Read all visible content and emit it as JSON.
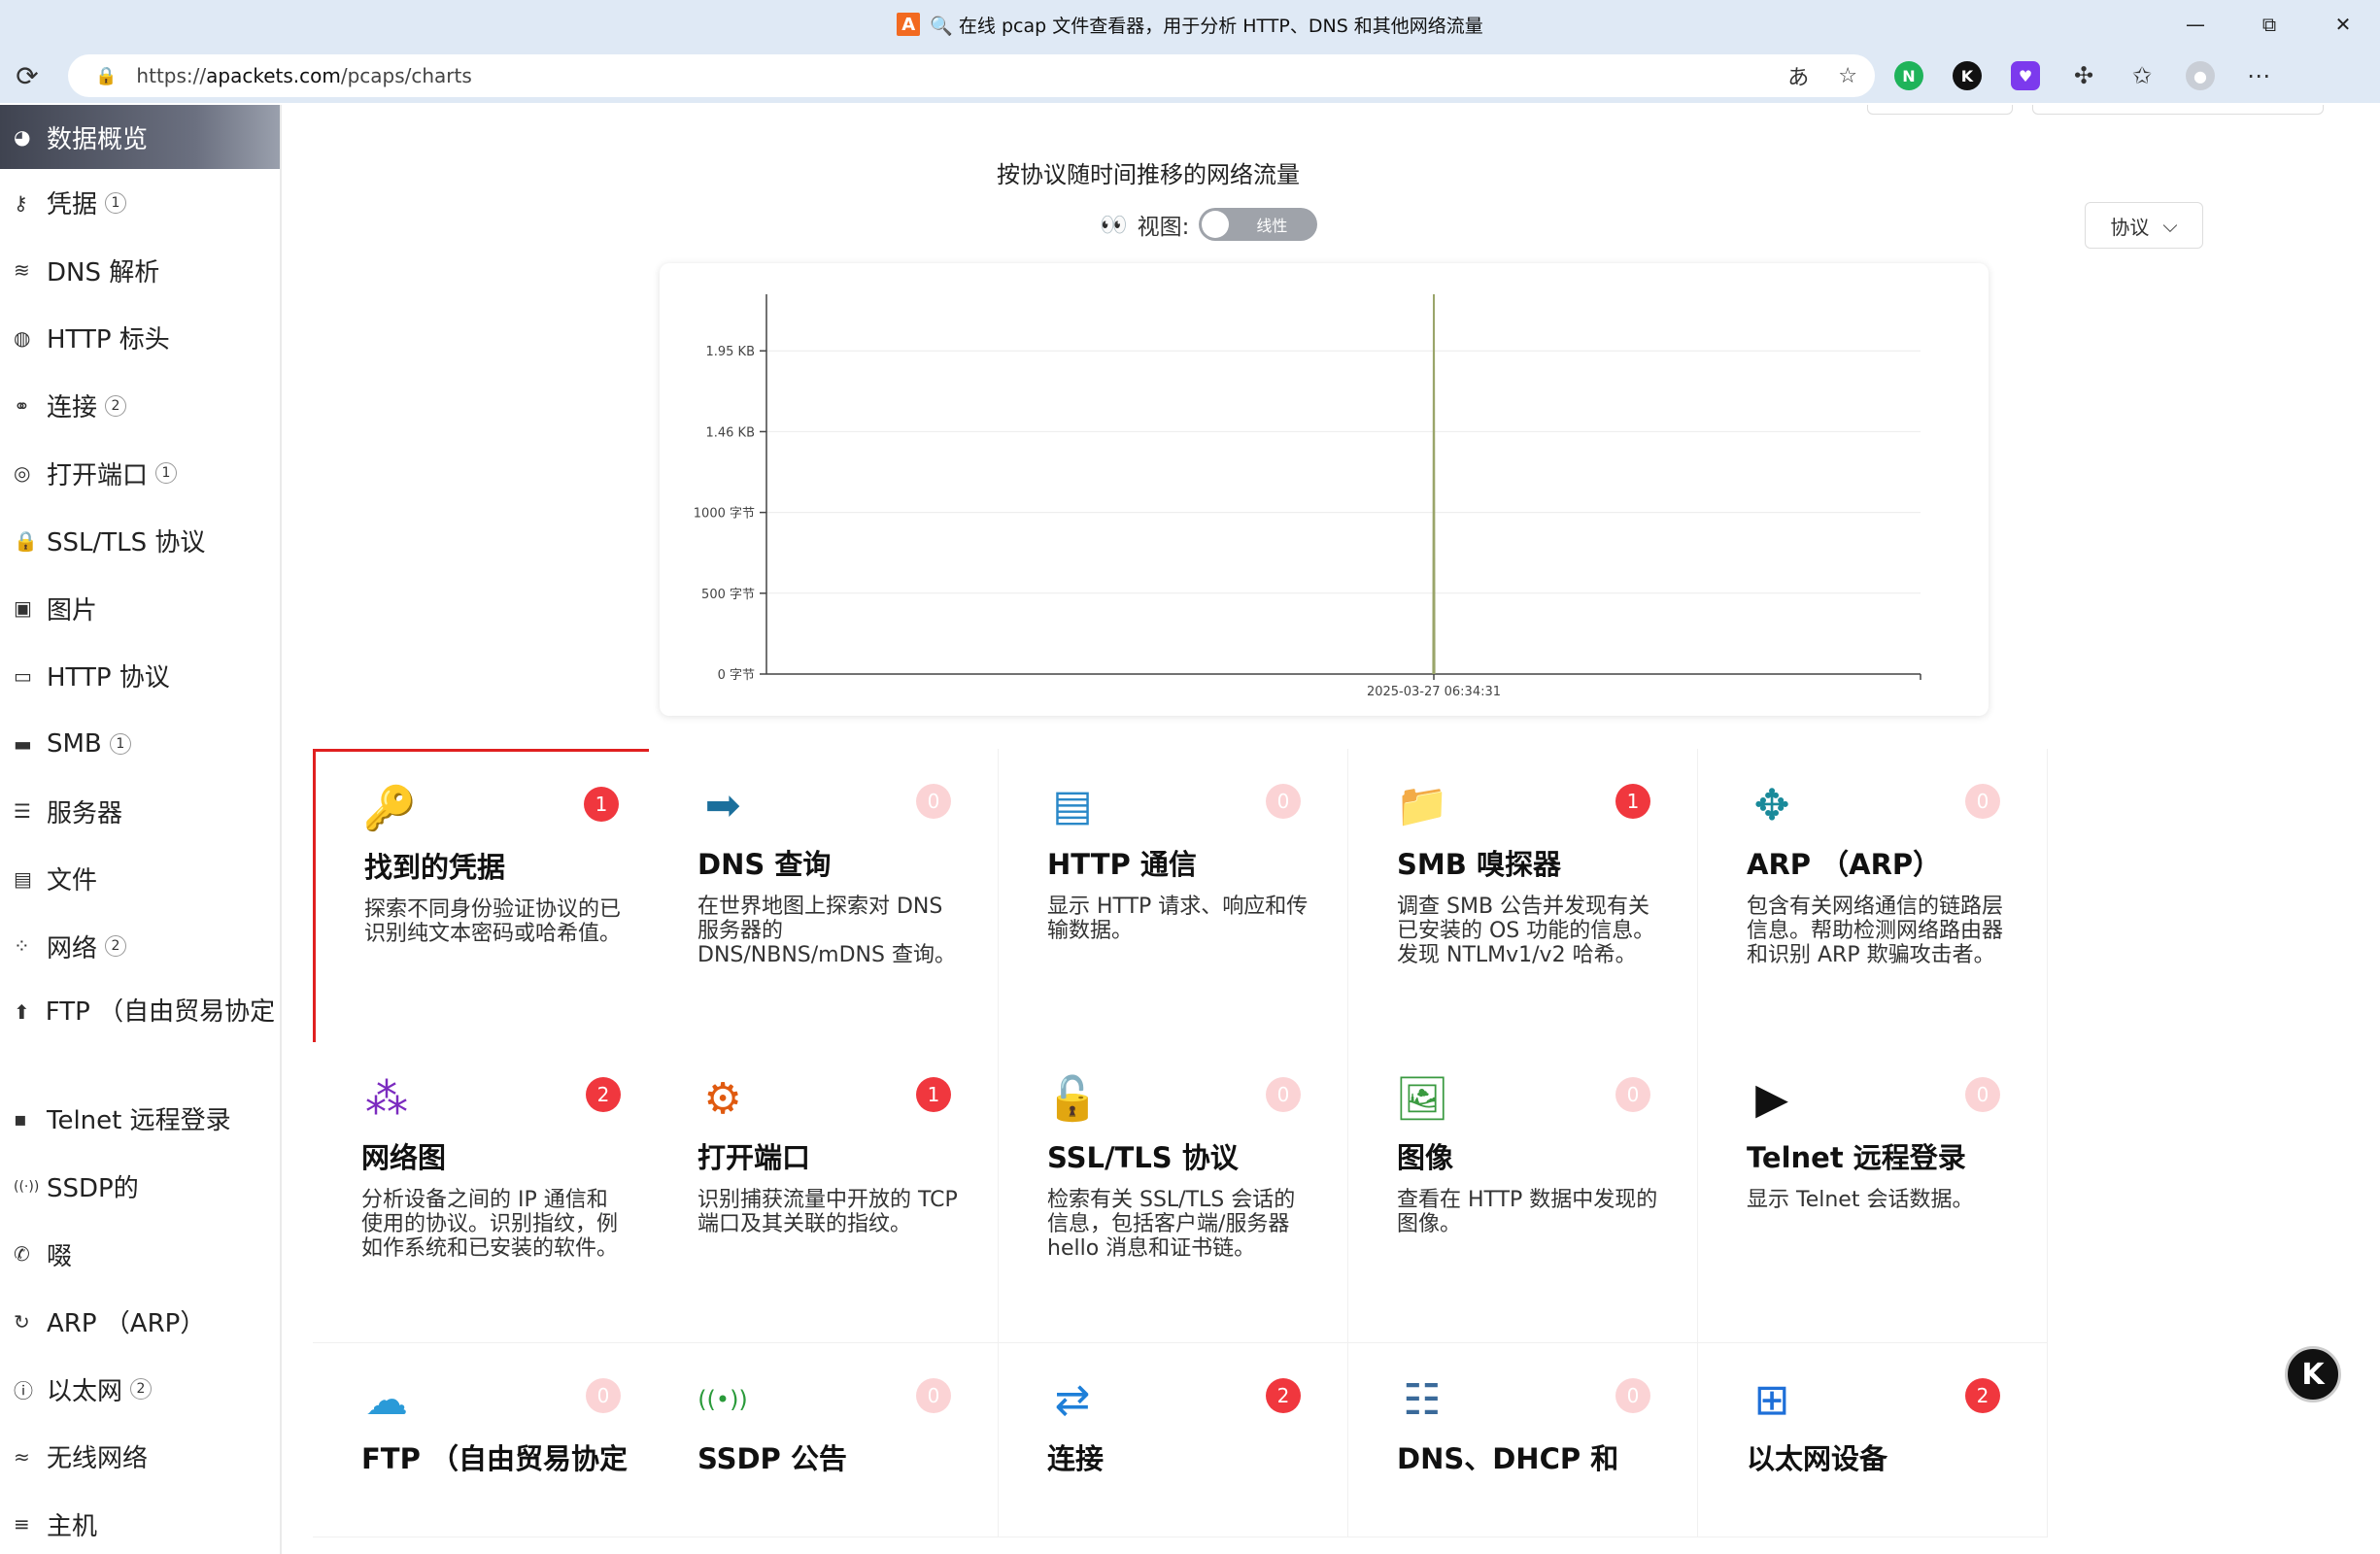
{
  "window": {
    "title": "🔍 在线 pcap 文件查看器，用于分析 HTTP、DNS 和其他网络流量",
    "minimize": "—",
    "maximize": "⧉",
    "close": "✕"
  },
  "browser": {
    "url_prefix": "https://",
    "url_host": "apackets.com",
    "url_path": "/pcaps/charts"
  },
  "sidebar": {
    "items": [
      {
        "label": "数据概览",
        "icon": "pie-icon",
        "count": ""
      },
      {
        "label": "凭据",
        "icon": "key-icon",
        "count": "1"
      },
      {
        "label": "DNS 解析",
        "icon": "database-icon",
        "count": ""
      },
      {
        "label": "HTTP 标头",
        "icon": "globe-icon",
        "count": ""
      },
      {
        "label": "连接",
        "icon": "link-icon",
        "count": "2"
      },
      {
        "label": "打开端口",
        "icon": "fingerprint-icon",
        "count": "1"
      },
      {
        "label": "SSL/TLS 协议",
        "icon": "lock-icon",
        "count": ""
      },
      {
        "label": "图片",
        "icon": "image-icon",
        "count": ""
      },
      {
        "label": "HTTP 协议",
        "icon": "monitor-icon",
        "count": ""
      },
      {
        "label": "SMB",
        "icon": "folder-icon",
        "count": "1"
      },
      {
        "label": "服务器",
        "icon": "server-icon",
        "count": ""
      },
      {
        "label": "文件",
        "icon": "file-icon",
        "count": ""
      },
      {
        "label": "网络",
        "icon": "network-icon",
        "count": "2"
      },
      {
        "label": "FTP （自由贸易协定",
        "icon": "file-upload-icon",
        "count": ""
      },
      {
        "label": "Telnet 远程登录",
        "icon": "terminal-icon",
        "count": ""
      },
      {
        "label": "SSDP的",
        "icon": "broadcast-icon",
        "count": ""
      },
      {
        "label": "啜",
        "icon": "phone-icon",
        "count": ""
      },
      {
        "label": "ARP （ARP）",
        "icon": "refresh-icon",
        "count": ""
      },
      {
        "label": "以太网",
        "icon": "info-icon",
        "count": "2"
      },
      {
        "label": "无线网络",
        "icon": "wifi-icon",
        "count": ""
      },
      {
        "label": "主机",
        "icon": "list-icon",
        "count": ""
      }
    ]
  },
  "chart_section": {
    "view_label": "视图:",
    "toggle_label": "线性",
    "protocol_button": "协议"
  },
  "chart_data": {
    "type": "line",
    "title": "按协议随时间推移的网络流量",
    "y_ticks": [
      "0 字节",
      "500 字节",
      "1000 字节",
      "1.46 KB",
      "1.95 KB"
    ],
    "y_tick_values": [
      0,
      500,
      1000,
      1500,
      2000
    ],
    "ylim": [
      0,
      2350
    ],
    "x_ticks": [
      "2025-03-27 06:34:31"
    ],
    "series": [
      {
        "values": [
          0,
          2350,
          0
        ],
        "color": "#9aa56a"
      }
    ],
    "grid": true
  },
  "cards": [
    {
      "title": "找到的凭据",
      "desc": "探索不同身份验证协议的已识别纯文本密码或哈希值。",
      "badge": "1",
      "icon": "key-icon",
      "active": true
    },
    {
      "title": "DNS 查询",
      "desc": "在世界地图上探索对 DNS 服务器的 DNS/NBNS/mDNS 查询。",
      "badge": "0",
      "icon": "arrow-circle-icon",
      "active": false
    },
    {
      "title": "HTTP 通信",
      "desc": "显示 HTTP 请求、响应和传输数据。",
      "badge": "0",
      "icon": "browser-window-icon",
      "active": false
    },
    {
      "title": "SMB 嗅探器",
      "desc": "调查 SMB 公告并发现有关已安装的 OS 功能的信息。发现 NTLMv1/v2 哈希。",
      "badge": "1",
      "icon": "folder-icon",
      "active": true
    },
    {
      "title": "ARP （ARP）",
      "desc": "包含有关网络通信的链路层信息。帮助检测网络路由器和识别 ARP 欺骗攻击者。",
      "badge": "0",
      "icon": "move-arrows-icon",
      "active": false
    },
    {
      "title": "网络图",
      "desc": "分析设备之间的 IP 通信和使用的协议。识别指纹，例如作系统和已安装的软件。",
      "badge": "2",
      "icon": "graph-icon",
      "active": true
    },
    {
      "title": "打开端口",
      "desc": "识别捕获流量中开放的 TCP 端口及其关联的指纹。",
      "badge": "1",
      "icon": "gears-icon",
      "active": true
    },
    {
      "title": "SSL/TLS 协议",
      "desc": "检索有关 SSL/TLS 会话的信息，包括客户端/服务器 hello 消息和证书链。",
      "badge": "0",
      "icon": "ssl-lock-icon",
      "active": false
    },
    {
      "title": "图像",
      "desc": "查看在 HTTP 数据中发现的图像。",
      "badge": "0",
      "icon": "picture-icon",
      "active": false
    },
    {
      "title": "Telnet 远程登录",
      "desc": "显示 Telnet 会话数据。",
      "badge": "0",
      "icon": "terminal-icon",
      "active": false
    },
    {
      "title": "FTP （自由贸易协定",
      "desc": "",
      "badge": "0",
      "icon": "cloud-upload-icon",
      "active": false
    },
    {
      "title": "SSDP 公告",
      "desc": "",
      "badge": "0",
      "icon": "broadcast-icon",
      "active": false
    },
    {
      "title": "连接",
      "desc": "",
      "badge": "2",
      "icon": "exchange-icon",
      "active": true
    },
    {
      "title": "DNS、DHCP 和",
      "desc": "",
      "badge": "0",
      "icon": "server-rack-icon",
      "active": false
    },
    {
      "title": "以太网设备",
      "desc": "",
      "badge": "2",
      "icon": "ethernet-icon",
      "active": true
    }
  ]
}
